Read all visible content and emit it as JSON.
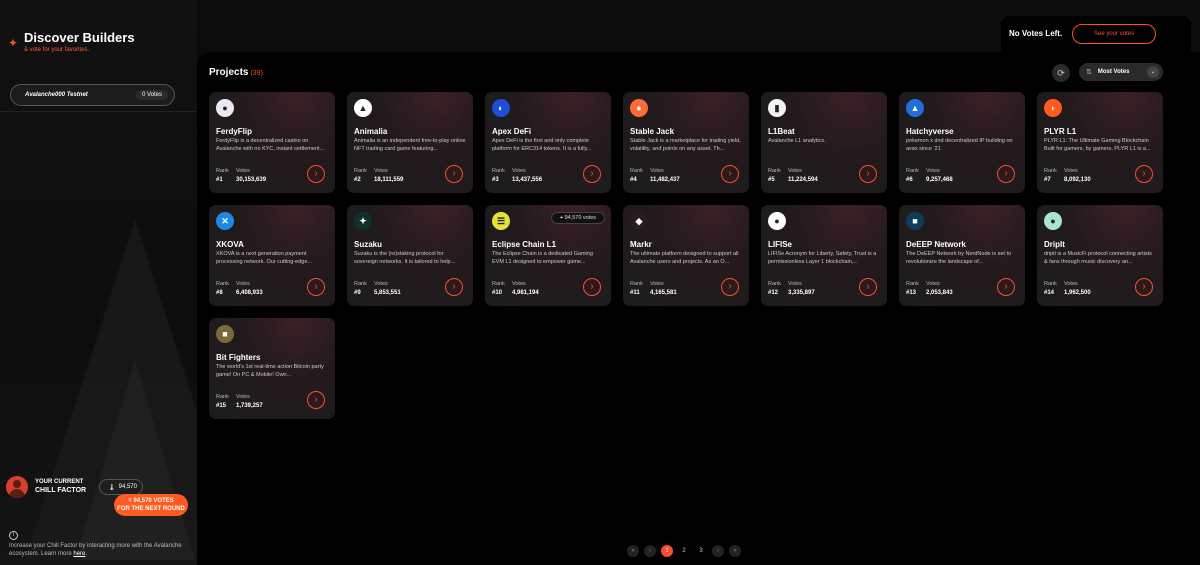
{
  "sidebar": {
    "title": "Discover Builders",
    "subtitle": "& vote for your favorites.",
    "network_name": "Avalanche000 Testnet",
    "network_votes": "0 Votes",
    "chill_label_1": "YOUR CURRENT",
    "chill_label_2": "CHILL FACTOR",
    "chill_value": "94,570",
    "next_round_line1": "= 94,570 VOTES",
    "next_round_line2": "FOR THE NEXT ROUND",
    "info_text": "Increase your Chill Factor by interacting more with the Avalanche ecosystem. Learn more",
    "info_link": "here"
  },
  "votes_box": {
    "status": "No Votes Left.",
    "button": "See your votes"
  },
  "projects": {
    "title": "Projects",
    "count": "(39)",
    "sort_label": "Most Votes",
    "rank_label": "Rank",
    "votes_label": "Votes",
    "items": [
      {
        "name": "FerdyFlip",
        "desc": "FerdyFlip is a decentralized casino on Avalanche with no KYC, instant settlement...",
        "rank": "#1",
        "votes": "30,153,639",
        "logo_color": "#e9e9f2",
        "logo_glyph": "●"
      },
      {
        "name": "Animalia",
        "desc": "Animalia is an independent free-to-play online NFT trading card game featuring...",
        "rank": "#2",
        "votes": "18,111,559",
        "logo_color": "#ffffff",
        "logo_glyph": "▲"
      },
      {
        "name": "Apex DeFi",
        "desc": "Apex DeFi is the first and only complete platform for ERC314 tokens. It is a fully...",
        "rank": "#3",
        "votes": "13,437,556",
        "logo_color": "#1c4fd6",
        "logo_glyph": "◐"
      },
      {
        "name": "Stable Jack",
        "desc": "Stable Jack is a marketplace for trading yield, volatility, and points on any asset. Th...",
        "rank": "#4",
        "votes": "11,482,437",
        "logo_color": "#ff6a3c",
        "logo_glyph": "●"
      },
      {
        "name": "L1Beat",
        "desc": "Avalanche L1 analytics.",
        "rank": "#5",
        "votes": "11,224,594",
        "logo_color": "#f2f2f2",
        "logo_glyph": "▮"
      },
      {
        "name": "Hatchyverse",
        "desc": "pokemon x dnd decentralized IP building on avax since '21",
        "rank": "#6",
        "votes": "9,257,468",
        "logo_color": "#1f6fd6",
        "logo_glyph": "▲"
      },
      {
        "name": "PLYR L1",
        "desc": "PLYR L1: The Ultimate Gaming Blockchain Built for gamers, by gamers, PLYR L1 is a...",
        "rank": "#7",
        "votes": "8,092,130",
        "logo_color": "#ff5a1f",
        "logo_glyph": "◗"
      },
      {
        "name": "XKOVA",
        "desc": "XKOVA is a next generation payment processing network. Our cutting-edge...",
        "rank": "#8",
        "votes": "6,408,933",
        "logo_color": "#1e88e5",
        "logo_glyph": "✕"
      },
      {
        "name": "Suzaku",
        "desc": "Suzaku is the (re)staking protocol for sovereign networks. It is tailored to help...",
        "rank": "#9",
        "votes": "5,853,551",
        "logo_color": "#10302a",
        "logo_glyph": "✦"
      },
      {
        "name": "Eclipse Chain L1",
        "desc": "The Eclipse Chain is a dedicated Gaming EVM L1 designed to empower game...",
        "rank": "#10",
        "votes": "4,981,194",
        "logo_color": "#e6e23a",
        "logo_glyph": "☰",
        "badge": "94,570 votes"
      },
      {
        "name": "Markr",
        "desc": "The ultimate platform designed to support all Avalanche users and projects. As an O...",
        "rank": "#11",
        "votes": "4,165,581",
        "logo_color": "#2a1b1d",
        "logo_glyph": "◆"
      },
      {
        "name": "LIFISe",
        "desc": "LIFISe Acronym for Liberty, Safety, Trust is a permissionless Layer 1 blockchain,...",
        "rank": "#12",
        "votes": "3,335,897",
        "logo_color": "#ffffff",
        "logo_glyph": "●"
      },
      {
        "name": "DeEEP Network",
        "desc": "The DeEEP Network by NerdNode is set to revolutionize the landscape of...",
        "rank": "#13",
        "votes": "2,053,843",
        "logo_color": "#0d3d5a",
        "logo_glyph": "■"
      },
      {
        "name": "DripIt",
        "desc": "dripit is a MusicFi protocol connecting artists & fans through music discovery an...",
        "rank": "#14",
        "votes": "1,962,500",
        "logo_color": "#a8e6cf",
        "logo_glyph": "●"
      },
      {
        "name": "Bit Fighters",
        "desc": "The world's 1st real-time action Bitcoin party game! On PC & Mobile! Own...",
        "rank": "#15",
        "votes": "1,739,257",
        "logo_color": "#7a6a3a",
        "logo_glyph": "■"
      }
    ]
  },
  "pagination": {
    "first": "«",
    "prev": "‹",
    "pages": [
      "1",
      "2",
      "3"
    ],
    "next": "›",
    "last": "»"
  },
  "colors": {
    "accent": "#ff4b33",
    "panel": "#000000",
    "card": "#1c1c1c"
  }
}
